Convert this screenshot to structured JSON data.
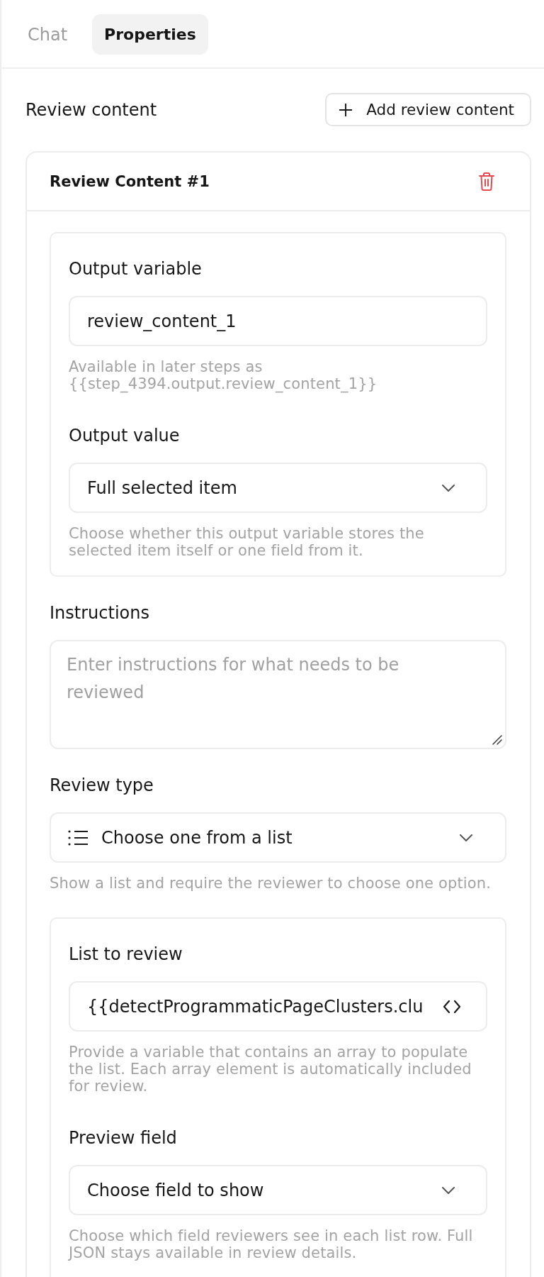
{
  "tabs": [
    {
      "label": "Chat",
      "selected": false
    },
    {
      "label": "Properties",
      "selected": true
    }
  ],
  "section": {
    "title": "Review content",
    "add_button": {
      "label": "Add review content"
    }
  },
  "review_items": [
    {
      "title": "Review Content #1",
      "blocks": [
        {
          "kind": "group",
          "fields": [
            {
              "kind": "text",
              "label": "Output variable",
              "value": "review_content_1",
              "hint": "Available in later steps as {{step_4394.output.review_content_1}}"
            },
            {
              "kind": "select",
              "label": "Output value",
              "value": "Full selected item",
              "hint": "Choose whether this output variable stores the selected item itself or one field from it."
            }
          ]
        },
        {
          "kind": "textarea",
          "label": "Instructions",
          "placeholder": "Enter instructions for what needs to be reviewed"
        },
        {
          "kind": "listselect",
          "label": "Review type",
          "value": "Choose one from a list",
          "hint": "Show a list and require the reviewer to choose one option."
        },
        {
          "kind": "group",
          "fields": [
            {
              "kind": "code",
              "label": "List to review",
              "value": "{{detectProgrammaticPageClusters.clu",
              "hint": "Provide a variable that contains an array to populate the list. Each array element is automatically included for review."
            },
            {
              "kind": "select",
              "label": "Preview field",
              "value": "Choose field to show",
              "hint": "Choose which field reviewers see in each list row. Full JSON stays available in review details."
            }
          ]
        }
      ]
    }
  ]
}
